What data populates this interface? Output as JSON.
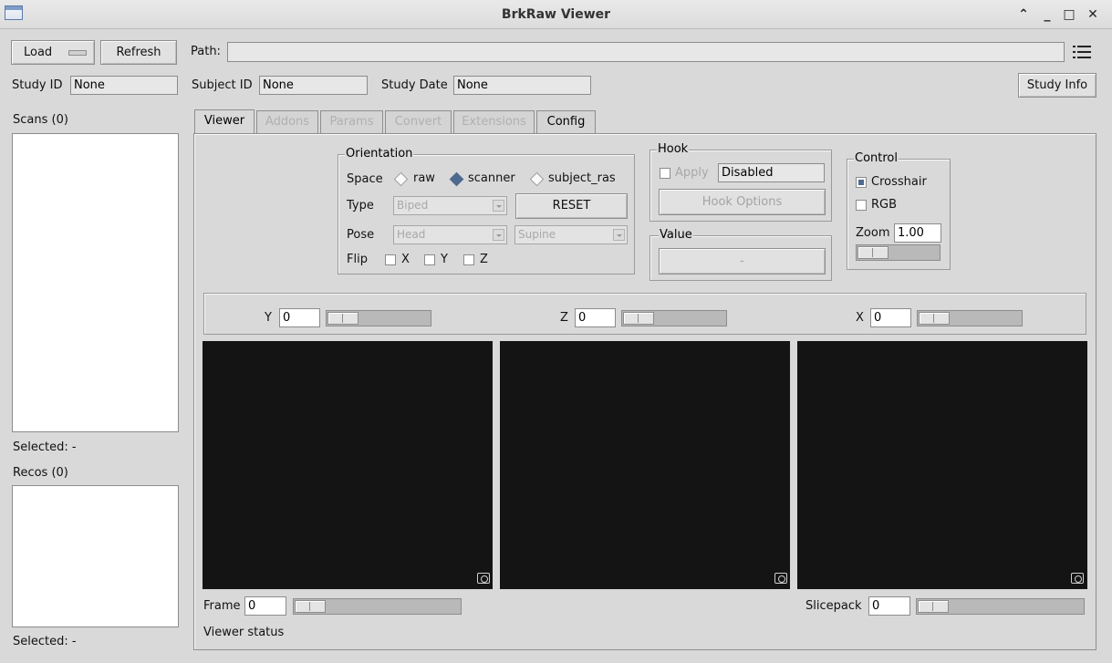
{
  "window": {
    "title": "BrkRaw Viewer"
  },
  "icons": {
    "window": "app-window-icon",
    "menu": "list-menu-icon",
    "snapshot": "camera-snapshot-icon"
  },
  "toolbar": {
    "load_label": "Load",
    "refresh_label": "Refresh",
    "path_label": "Path:",
    "path_value": ""
  },
  "info": {
    "study_id_label": "Study ID",
    "study_id_value": "None",
    "subject_id_label": "Subject ID",
    "subject_id_value": "None",
    "study_date_label": "Study Date",
    "study_date_value": "None",
    "study_info_label": "Study Info"
  },
  "sidebar": {
    "scans_label": "Scans (0)",
    "scans_selected": "Selected: -",
    "recos_label": "Recos (0)",
    "recos_selected": "Selected: -"
  },
  "tabs": [
    "Viewer",
    "Addons",
    "Params",
    "Convert",
    "Extensions",
    "Config"
  ],
  "orientation": {
    "title": "Orientation",
    "space_label": "Space",
    "space_options": [
      "raw",
      "scanner",
      "subject_ras"
    ],
    "space_selected": "scanner",
    "type_label": "Type",
    "type_value": "Biped",
    "reset_label": "RESET",
    "pose_label": "Pose",
    "pose_value": "Head",
    "pose_value2": "Supine",
    "flip_label": "Flip",
    "flip_options": [
      "X",
      "Y",
      "Z"
    ]
  },
  "hook": {
    "title": "Hook",
    "apply_label": "Apply",
    "status_value": "Disabled",
    "options_label": "Hook Options"
  },
  "value": {
    "title": "Value",
    "value_text": "-"
  },
  "control": {
    "title": "Control",
    "crosshair_label": "Crosshair",
    "crosshair_checked": true,
    "rgb_label": "RGB",
    "rgb_checked": false,
    "zoom_label": "Zoom",
    "zoom_value": "1.00"
  },
  "axes": {
    "y_label": "Y",
    "y_value": "0",
    "z_label": "Z",
    "z_value": "0",
    "x_label": "X",
    "x_value": "0"
  },
  "frame": {
    "label": "Frame",
    "value": "0"
  },
  "slicepack": {
    "label": "Slicepack",
    "value": "0"
  },
  "status": {
    "text": "Viewer status"
  },
  "colors": {
    "background": "#d9d9d9",
    "canvas": "#141414",
    "accent": "#4f6a8f"
  }
}
